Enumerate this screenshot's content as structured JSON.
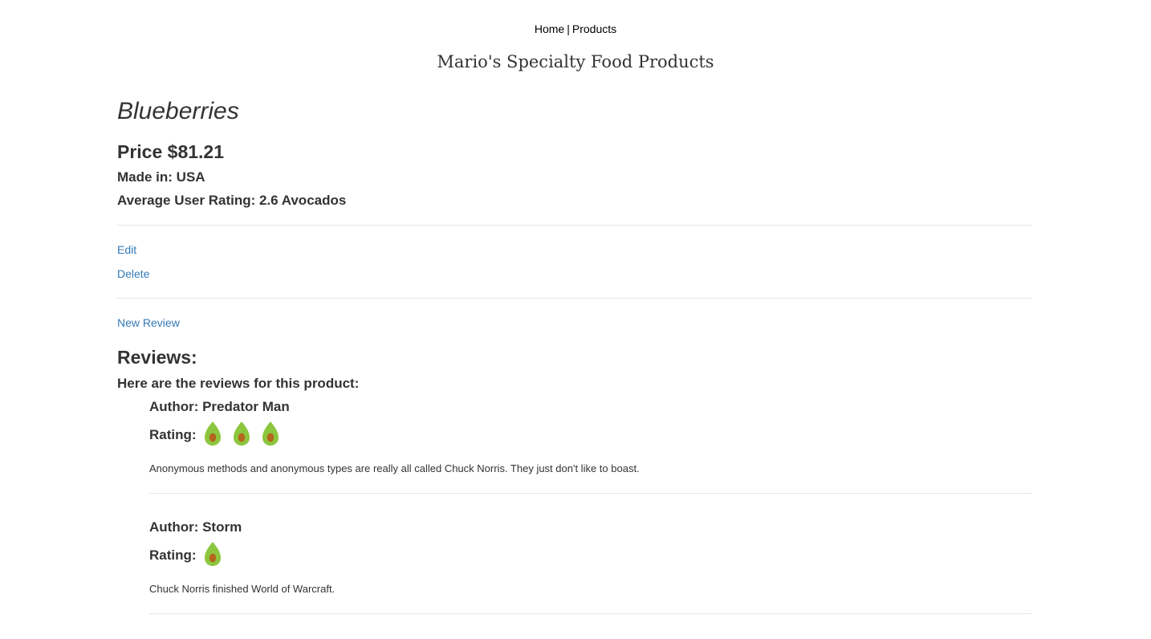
{
  "nav": {
    "home": "Home",
    "separator": "|",
    "products": "Products"
  },
  "site_title": "Mario's Specialty Food Products",
  "product": {
    "name": "Blueberries",
    "price": "Price $81.21",
    "made_in": "Made in: USA",
    "average_rating": "Average User Rating: 2.6 Avocados"
  },
  "actions": {
    "edit": "Edit",
    "delete": "Delete",
    "new_review": "New Review"
  },
  "reviews_section": {
    "heading": "Reviews:",
    "intro": "Here are the reviews for this product:",
    "rating_label": "Rating:",
    "rating_icon": "avocado-icon",
    "items": [
      {
        "author": "Author: Predator Man",
        "rating": 3,
        "body": "Anonymous methods and anonymous types are really all called Chuck Norris. They just don't like to boast."
      },
      {
        "author": "Author: Storm",
        "rating": 1,
        "body": "Chuck Norris finished World of Warcraft."
      }
    ]
  },
  "colors": {
    "link": "#337ab7",
    "text": "#333333",
    "avocado_skin": "#8cc63f",
    "avocado_pit": "#b5651d"
  }
}
